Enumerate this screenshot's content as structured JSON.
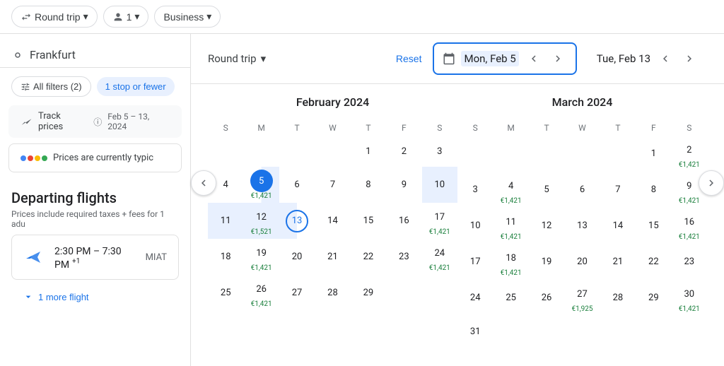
{
  "topBar": {
    "roundTripLabel": "Round trip",
    "passengersLabel": "1",
    "classLabel": "Business"
  },
  "leftPanel": {
    "searchCity": "Frankfurt",
    "filtersLabel": "All filters (2)",
    "stopsChip": "1 stop or fewer",
    "trackPricesLabel": "Track prices",
    "trackPricesDate": "Feb 5 – 13, 2024",
    "pricesTypicalLabel": "Prices are currently typic",
    "departingTitle": "Departing flights",
    "departingSub": "Prices include required taxes + fees for 1 adu",
    "flightTime": "2:30 PM – 7:30 PM",
    "flightSuperscript": "+1",
    "airlineName": "MIAT",
    "moreFlights": "1 more flight"
  },
  "calendar": {
    "roundTripLabel": "Round trip",
    "resetLabel": "Reset",
    "selectedStart": "Mon, Feb 5",
    "selectedEnd": "Tue, Feb 13",
    "feb2024": {
      "title": "February 2024",
      "dayHeaders": [
        "S",
        "M",
        "T",
        "W",
        "T",
        "F",
        "S"
      ],
      "weeks": [
        [
          null,
          null,
          null,
          null,
          {
            "n": 1
          },
          {
            "n": 2
          },
          {
            "n": 3
          }
        ],
        [
          {
            "n": 4
          },
          {
            "n": 5,
            "price": "€1,421",
            "selected": "start"
          },
          {
            "n": 6
          },
          {
            "n": 7
          },
          {
            "n": 8
          },
          {
            "n": 9
          },
          {
            "n": 10,
            "inrange": true
          }
        ],
        [
          {
            "n": 11,
            "inrange": true
          },
          {
            "n": 12,
            "price": "€1,521",
            "inrange": true
          },
          {
            "n": 13,
            "selected": "end"
          },
          {
            "n": 14
          },
          {
            "n": 15
          },
          {
            "n": 16
          },
          {
            "n": 17,
            "price": "€1,421"
          }
        ],
        [
          {
            "n": 18
          },
          {
            "n": 19,
            "price": "€1,421"
          },
          {
            "n": 20
          },
          {
            "n": 21
          },
          {
            "n": 22
          },
          {
            "n": 23
          },
          {
            "n": 24,
            "price": "€1,421"
          }
        ],
        [
          {
            "n": 25
          },
          {
            "n": 26,
            "price": "€1,421"
          },
          {
            "n": 27
          },
          {
            "n": 28
          },
          {
            "n": 29
          },
          null,
          null
        ]
      ]
    },
    "mar2024": {
      "title": "March 2024",
      "dayHeaders": [
        "S",
        "M",
        "T",
        "W",
        "T",
        "F",
        "S"
      ],
      "weeks": [
        [
          null,
          null,
          null,
          null,
          null,
          {
            "n": 1
          },
          {
            "n": 2,
            "price": "€1,421"
          }
        ],
        [
          {
            "n": 3
          },
          {
            "n": 4,
            "price": "€1,421"
          },
          {
            "n": 5
          },
          {
            "n": 6
          },
          {
            "n": 7
          },
          {
            "n": 8
          },
          {
            "n": 9,
            "price": "€1,421"
          }
        ],
        [
          {
            "n": 10
          },
          {
            "n": 11,
            "price": "€1,421"
          },
          {
            "n": 12
          },
          {
            "n": 13
          },
          {
            "n": 14
          },
          {
            "n": 15
          },
          {
            "n": 16,
            "price": "€1,421"
          }
        ],
        [
          {
            "n": 17
          },
          {
            "n": 18,
            "price": "€1,421"
          },
          {
            "n": 19
          },
          {
            "n": 20
          },
          {
            "n": 21
          },
          {
            "n": 22
          },
          {
            "n": 23
          }
        ],
        [
          {
            "n": 24
          },
          {
            "n": 25
          },
          {
            "n": 26
          },
          {
            "n": 27,
            "price": "€1,925"
          },
          {
            "n": 28
          },
          {
            "n": 29
          },
          {
            "n": 30,
            "price": "€1,421"
          }
        ],
        [
          {
            "n": 31
          },
          null,
          null,
          null,
          null,
          null,
          null
        ]
      ]
    }
  },
  "icons": {
    "roundtrip": "⇄",
    "person": "👤",
    "chevronDown": "▾",
    "calendar": "📅",
    "chevronLeft": "‹",
    "chevronRight": "›",
    "filter": "⊞",
    "trending": "📈",
    "info": "ⓘ"
  }
}
